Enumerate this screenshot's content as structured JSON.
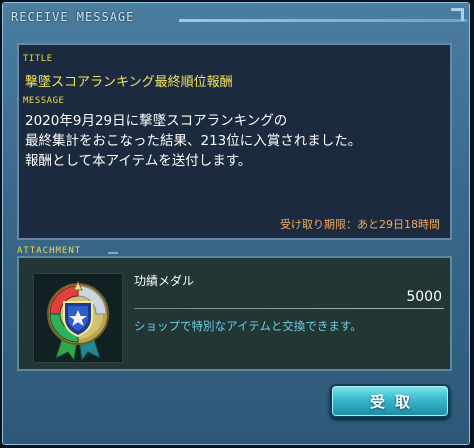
{
  "window": {
    "title": "RECEIVE MESSAGE"
  },
  "message": {
    "title_label": "TITLE",
    "title": "撃墜スコアランキング最終順位報酬",
    "body_label": "MESSAGE",
    "body_lines": [
      "2020年9月29日に撃墜スコアランキングの",
      "最終集計をおこなった結果、213位に入賞されました。",
      "報酬として本アイテムを送付します。"
    ],
    "deadline": "受け取り期限：あと29日18時間"
  },
  "attachment": {
    "label": "ATTACHMENT",
    "item_name": "功績メダル",
    "item_count": "5000",
    "item_description": "ショップで特別なアイテムと交換できます。",
    "item_icon": "medal-icon"
  },
  "buttons": {
    "receive_label": "受取"
  },
  "colors": {
    "frame": "#3b6a8c",
    "title_yellow": "#f2e55a",
    "deadline_orange": "#f0a860",
    "desc_cyan": "#6fd0e8",
    "button_cyan": "#39b9cc"
  }
}
